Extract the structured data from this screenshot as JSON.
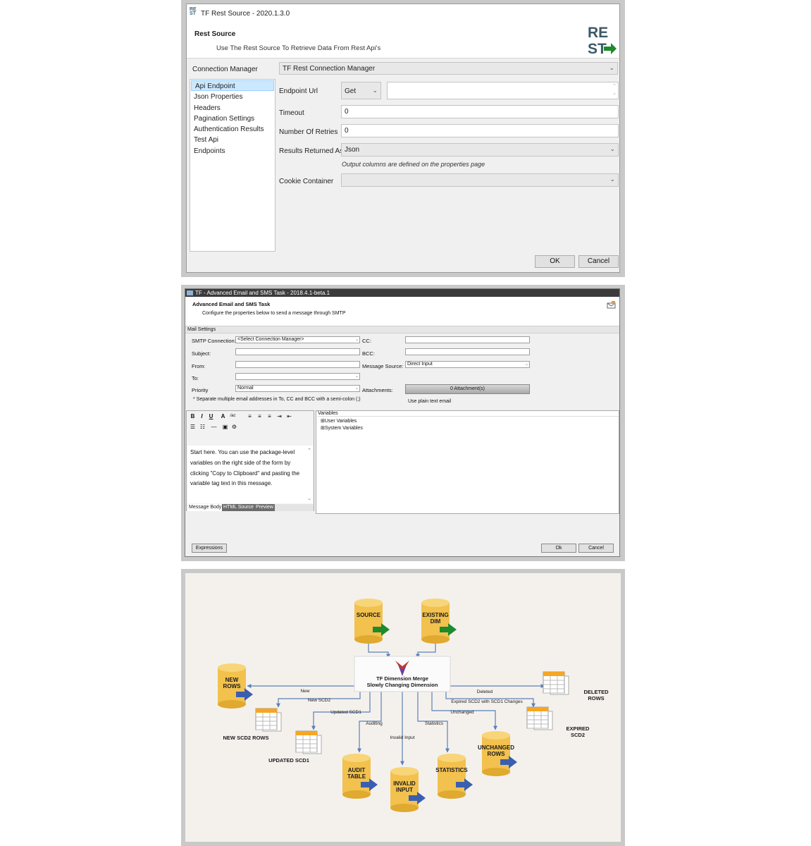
{
  "rest": {
    "window_title": "TF Rest Source - 2020.1.3.0",
    "heading": "Rest Source",
    "subheading": "Use The Rest Source To Retrieve Data From Rest Api's",
    "logo_top": "RE",
    "logo_bottom": "ST",
    "connection_label": "Connection Manager",
    "connection_value": "TF Rest Connection Manager",
    "nav": [
      "Api Endpoint",
      "Json Properties",
      "Headers",
      "Pagination Settings",
      "Authentication Results",
      "Test Api",
      "Endpoints"
    ],
    "endpoint_label": "Endpoint Url",
    "method_value": "Get",
    "endpoint_value": "",
    "timeout_label": "Timeout",
    "timeout_value": "0",
    "retries_label": "Number Of Retries",
    "retries_value": "0",
    "results_label": "Results Returned As",
    "results_value": "Json",
    "results_hint": "Output columns are defined on the properties page",
    "cookie_label": "Cookie Container",
    "cookie_value": "",
    "ok": "OK",
    "cancel": "Cancel"
  },
  "email": {
    "window_title": "TF - Advanced Email and SMS Task - 2018.4.1-beta.1",
    "heading": "Advanced Email and SMS Task",
    "subheading": "Configure the properties below to send a message through SMTP",
    "group": "Mail Settings",
    "smtp_label": "SMTP Connection:",
    "smtp_value": "<Select Connection Manager>",
    "subject_label": "Subject:",
    "from_label": "From:",
    "to_label": "To:",
    "priority_label": "Priority",
    "priority_value": "Normal",
    "cc_label": "CC:",
    "bcc_label": "BCC:",
    "source_label": "Message Source:",
    "source_value": "Direct Input",
    "attach_label": "Attachments:",
    "attach_value": "0 Attachment(s)",
    "note": "* Separate multiple email addresses in To, CC and BCC with a semi-colon (;)",
    "plain_text": "Use plain text email",
    "body_text": "Start here. You can use the package-level variables on the right side of the form by clicking \"Copy to Clipboard\" and pasting the variable tag text in this message.",
    "tab_body": "Message Body",
    "tab_html": "HTML Source",
    "tab_preview": "Preview",
    "vars_header": "Variables",
    "vars": [
      "User Variables",
      "System Variables"
    ],
    "expressions": "Expressions",
    "ok": "Ok",
    "cancel": "Cancel"
  },
  "diagram": {
    "center_line1": "TF Dimension Merge",
    "center_line2": "Slowly Changing Dimension",
    "cylinders": {
      "source": [
        "SOURCE"
      ],
      "existing": [
        "EXISTING",
        "DIM"
      ],
      "new_rows": [
        "NEW",
        "ROWS"
      ],
      "audit": [
        "AUDIT",
        "TABLE"
      ],
      "invalid": [
        "INVALID",
        "INPUT"
      ],
      "statistics": [
        "STATISTICS"
      ],
      "unchanged": [
        "UNCHANGED",
        "ROWS"
      ]
    },
    "tables": {
      "new_scd2": "NEW SCD2 ROWS",
      "updated_scd1": "UPDATED SCD1",
      "deleted": [
        "DELETED",
        "ROWS"
      ],
      "expired": [
        "EXPIRED",
        "SCD2"
      ]
    },
    "edges": {
      "new": "New",
      "new_scd2": "New SCD2",
      "updated_scd1": "Updated SCD1",
      "auditing": "Auditing",
      "invalid_input": "Invalid Input",
      "statistics": "Statistics",
      "unchanged": "Unchanged",
      "expired": "Expired SCD2 with SCD1 Changes",
      "deleted": "Deleted"
    },
    "colors": {
      "cylinder": "#f2c14e",
      "out_arrow": "#3a5fb0",
      "in_arrow": "#1e8a2c",
      "line": "#5b80b8",
      "table_header": "#f5a623"
    }
  }
}
